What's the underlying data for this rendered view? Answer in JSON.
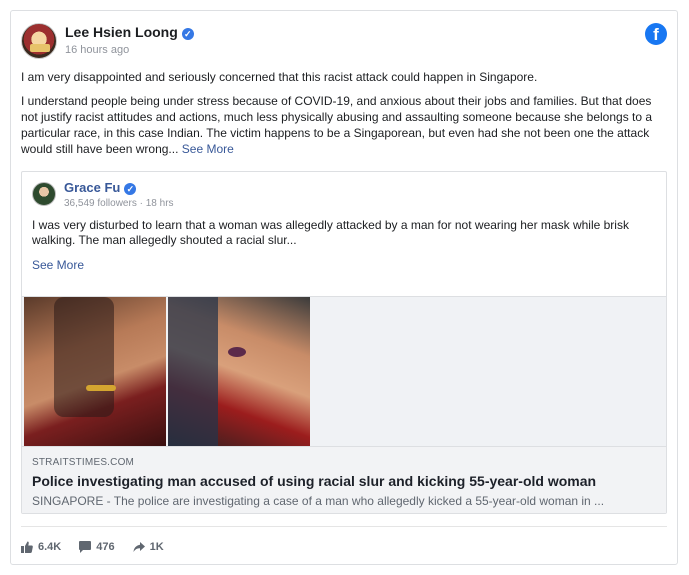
{
  "post": {
    "author": "Lee Hsien Loong",
    "time": "16 hours ago",
    "paragraph1": "I am very disappointed and seriously concerned that this racist attack could happen in Singapore.",
    "paragraph2": "I understand people being under stress because of COVID-19, and anxious about their jobs and families. But that does not justify racist attitudes and actions, much less physically abusing and assaulting someone because she belongs to a particular race, in this case Indian. The victim happens to be a Singaporean, but even had she not been one the attack would still have been wrong...",
    "see_more": "See More",
    "brand_icon": "facebook-icon",
    "verified_icon": "verified-check-icon"
  },
  "shared": {
    "author": "Grace Fu",
    "followers": "36,549 followers",
    "time": "18 hrs",
    "separator": "·",
    "text": "I was very disturbed to learn that a woman was allegedly attacked by a man for not wearing her mask while brisk walking. The man allegedly shouted a racial slur...",
    "see_more": "See More"
  },
  "link_preview": {
    "domain": "STRAITSTIMES.COM",
    "title": "Police investigating man accused of using racial slur and kicking 55-year-old woman",
    "description": "SINGAPORE - The police are investigating a case of a man who allegedly kicked a 55-year-old woman in ..."
  },
  "stats": {
    "likes": "6.4K",
    "comments": "476",
    "shares": "1K"
  },
  "colors": {
    "link": "#385898",
    "facebook_blue": "#1877f2",
    "verified": "#3578e5",
    "muted": "#606770"
  }
}
